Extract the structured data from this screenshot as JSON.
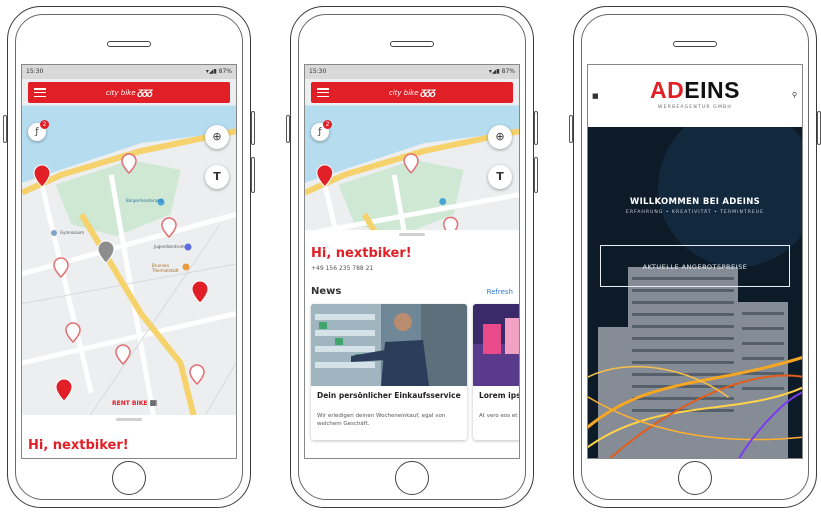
{
  "phone1": {
    "status": {
      "time": "15:30",
      "icons": "▾◢▮ 87%"
    },
    "appbar": {
      "brand_small": "city bike",
      "brand_large": "ᵹᵹᵹ"
    },
    "filter_badge": "2",
    "map_labels": [
      "Bürgermeisteramt",
      "Jugendzentrum",
      "Brunnen Thermalstadt",
      "Gymnasium"
    ],
    "rent_bike_label": "RENT BIKE",
    "greeting": "Hi, nextbiker!"
  },
  "phone2": {
    "status": {
      "time": "15:30",
      "icons": "▾◢▮ 87%"
    },
    "appbar": {
      "brand_small": "city bike",
      "brand_large": "ᵹᵹᵹ"
    },
    "filter_badge": "2",
    "greeting": "Hi, nextbiker!",
    "phone_number": "+49 156 235 788 21",
    "news": {
      "title": "News",
      "refresh": "Refresh",
      "cards": [
        {
          "title": "Dein persönlicher Einkaufsservice",
          "desc": "Wir erledigen deinen Wocheneinkauf, egal von welchem Geschäft."
        },
        {
          "title": "Lorem ipsu consetur s",
          "desc": "At vero eos et ac dolorem"
        }
      ]
    }
  },
  "phone3": {
    "logo_ad": "AD",
    "logo_eins": "EINS",
    "logo_sub": "WERBEAGENTUR GMBH",
    "welcome": "WILLKOMMEN BEI ADEINS",
    "tagline": "ERFAHRUNG • KREATIVITÄT • TERMINTREUE",
    "cta": "AKTUELLE ANGEBOTSPREISE"
  },
  "colors": {
    "brand_red": "#e01f26",
    "map_bg": "#edeef0",
    "road_yellow": "#f5d26b",
    "park_green": "#cfe8d4"
  }
}
